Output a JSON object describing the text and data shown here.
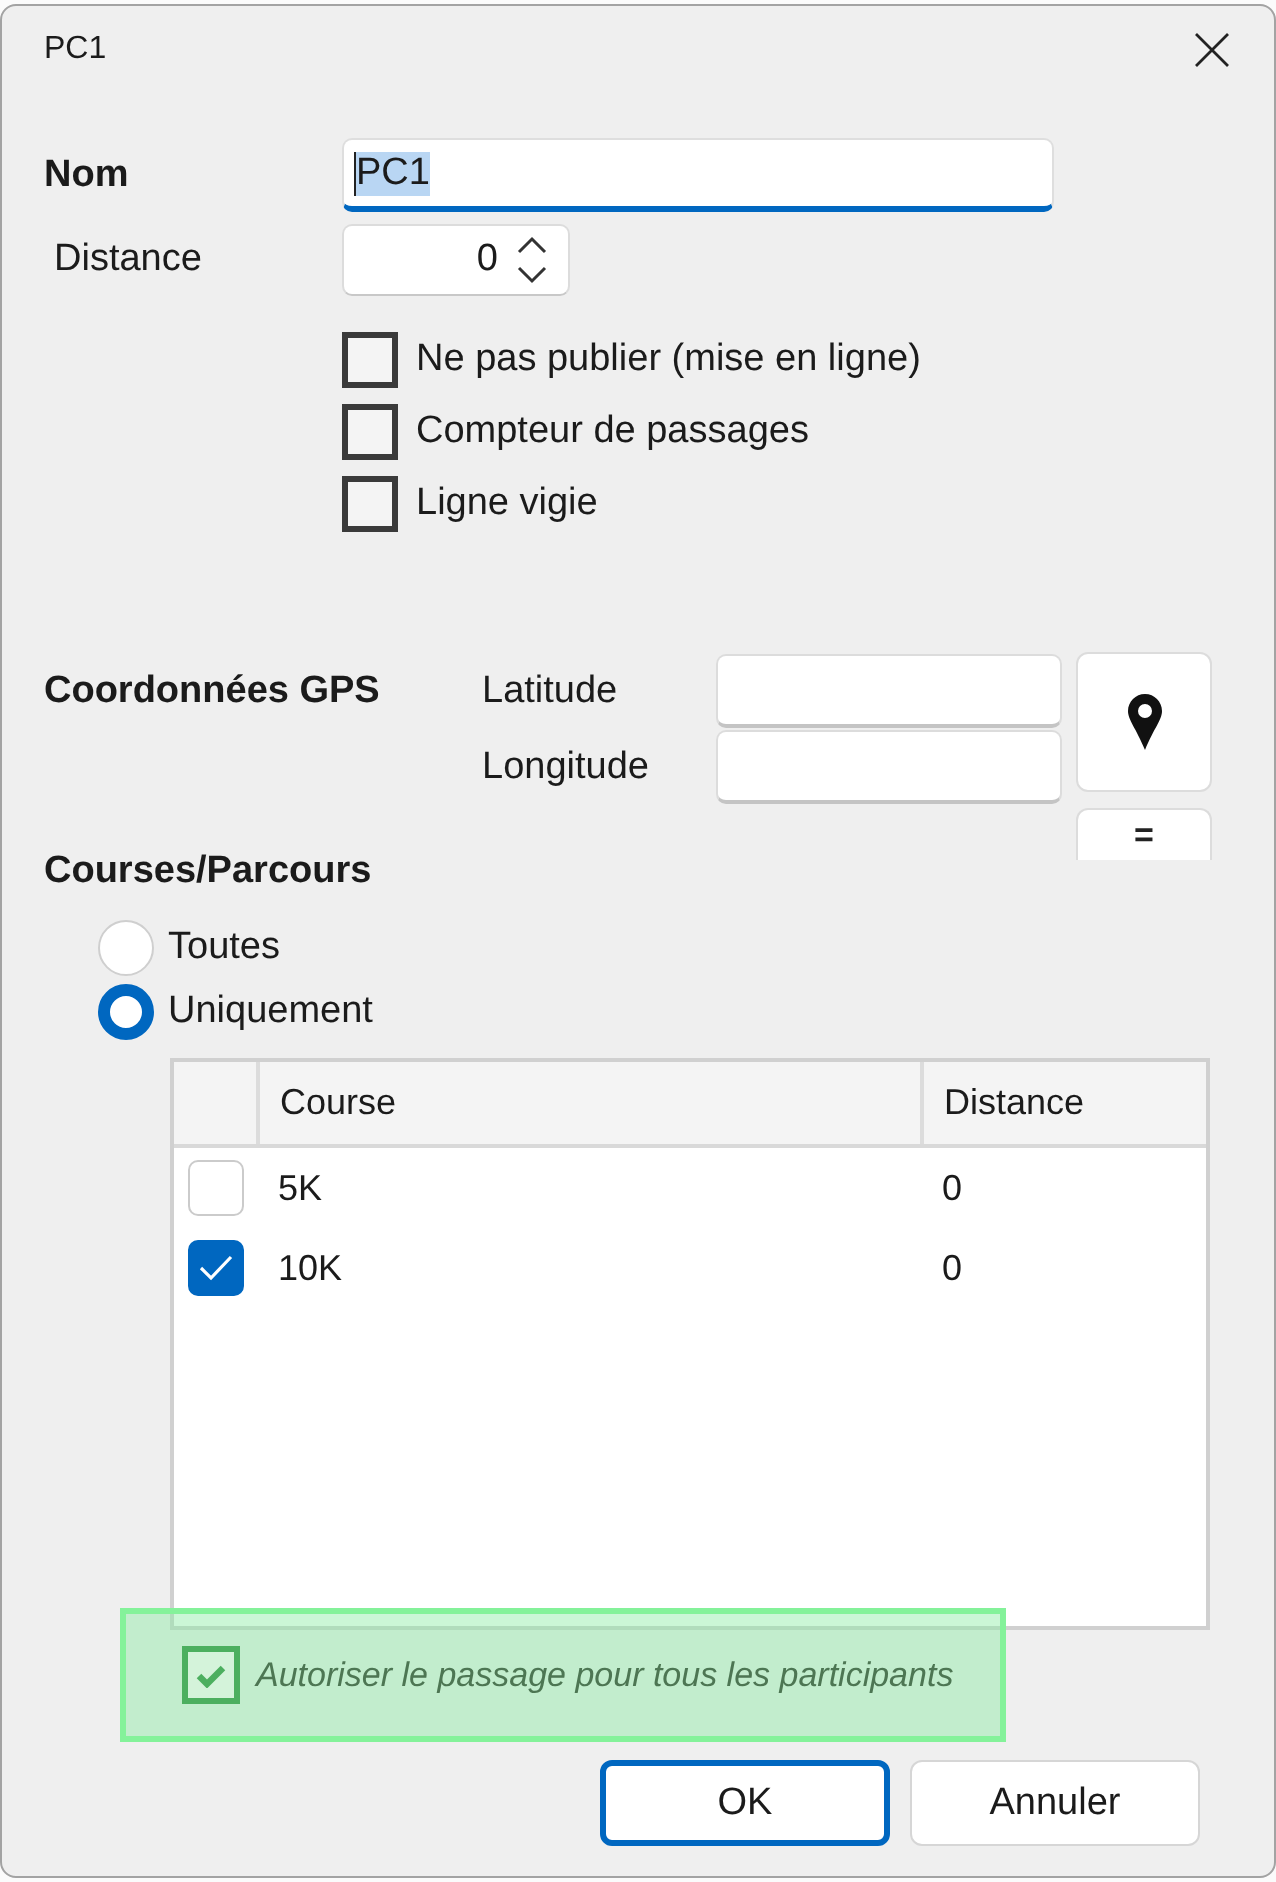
{
  "window": {
    "title": "PC1"
  },
  "name_field": {
    "label": "Nom",
    "value": "PC1",
    "focused": true
  },
  "distance_field": {
    "label": "Distance",
    "value": "0"
  },
  "options": [
    {
      "label": "Ne pas publier (mise en ligne)",
      "checked": false
    },
    {
      "label": "Compteur de passages",
      "checked": false
    },
    {
      "label": "Ligne vigie",
      "checked": false
    }
  ],
  "gps": {
    "label": "Coordonnées GPS",
    "fields": [
      {
        "label": "Latitude"
      },
      {
        "label": "Longitude"
      }
    ],
    "equals_button": "="
  },
  "courses": {
    "label": "Courses/Parcours",
    "scope_options": [
      {
        "label": "Toutes",
        "selected": false
      },
      {
        "label": "Uniquement",
        "selected": true
      }
    ],
    "table": {
      "columns": [
        "Course",
        "Distance"
      ],
      "rows": [
        {
          "checked": false,
          "cells": [
            "5K",
            "0"
          ]
        },
        {
          "checked": true,
          "cells": [
            "10K",
            "0"
          ]
        }
      ]
    }
  },
  "allow_all": {
    "label": "Autoriser le passage pour tous les participants",
    "checked": true,
    "highlighted": true
  },
  "buttons": [
    {
      "label": "OK",
      "default": true
    },
    {
      "label": "Annuler",
      "default": false
    }
  ]
}
